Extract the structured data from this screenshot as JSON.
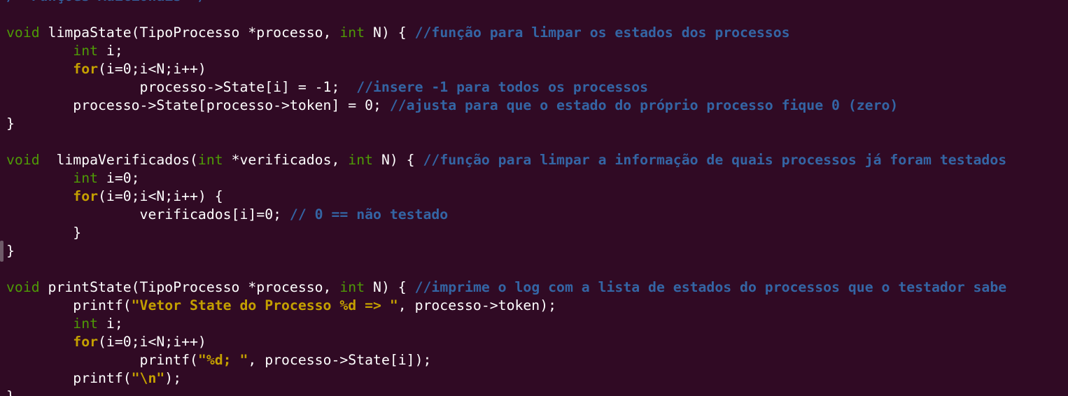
{
  "editor": {
    "colors": {
      "background": "#300a24",
      "default": "#ffffff",
      "type": "#4e9a06",
      "keyword": "#c4a000",
      "string": "#c4a000",
      "comment": "#3465a4"
    },
    "lines": [
      [
        {
          "c": "cmt",
          "t": "/* Funções Adicionais */"
        }
      ],
      [],
      [
        {
          "c": "type",
          "t": "void"
        },
        {
          "c": "",
          "t": " limpaState(TipoProcesso *processo, "
        },
        {
          "c": "type",
          "t": "int"
        },
        {
          "c": "",
          "t": " N) { "
        },
        {
          "c": "cmt",
          "t": "//função para limpar os estados dos processos"
        }
      ],
      [
        {
          "c": "",
          "t": "        "
        },
        {
          "c": "type",
          "t": "int"
        },
        {
          "c": "",
          "t": " i;"
        }
      ],
      [
        {
          "c": "",
          "t": "        "
        },
        {
          "c": "kw",
          "t": "for"
        },
        {
          "c": "",
          "t": "(i=0;i<N;i++)"
        }
      ],
      [
        {
          "c": "",
          "t": "                processo->State[i] = -1;  "
        },
        {
          "c": "cmt",
          "t": "//insere -1 para todos os processos"
        }
      ],
      [
        {
          "c": "",
          "t": "        processo->State[processo->token] = 0; "
        },
        {
          "c": "cmt",
          "t": "//ajusta para que o estado do próprio processo fique 0 (zero)"
        }
      ],
      [
        {
          "c": "",
          "t": "}"
        }
      ],
      [],
      [
        {
          "c": "type",
          "t": "void"
        },
        {
          "c": "",
          "t": "  limpaVerificados("
        },
        {
          "c": "type",
          "t": "int"
        },
        {
          "c": "",
          "t": " *verificados, "
        },
        {
          "c": "type",
          "t": "int"
        },
        {
          "c": "",
          "t": " N) { "
        },
        {
          "c": "cmt",
          "t": "//função para limpar a informação de quais processos já foram testados"
        }
      ],
      [
        {
          "c": "",
          "t": "        "
        },
        {
          "c": "type",
          "t": "int"
        },
        {
          "c": "",
          "t": " i=0;"
        }
      ],
      [
        {
          "c": "",
          "t": "        "
        },
        {
          "c": "kw",
          "t": "for"
        },
        {
          "c": "",
          "t": "(i=0;i<N;i++) {"
        }
      ],
      [
        {
          "c": "",
          "t": "                verificados[i]=0; "
        },
        {
          "c": "cmt",
          "t": "// 0 == não testado"
        }
      ],
      [
        {
          "c": "",
          "t": "        }"
        }
      ],
      [
        {
          "c": "",
          "t": "}"
        }
      ],
      [],
      [
        {
          "c": "type",
          "t": "void"
        },
        {
          "c": "",
          "t": " printState(TipoProcesso *processo, "
        },
        {
          "c": "type",
          "t": "int"
        },
        {
          "c": "",
          "t": " N) { "
        },
        {
          "c": "cmt",
          "t": "//imprime o log com a lista de estados do processos que o testador sabe"
        }
      ],
      [
        {
          "c": "",
          "t": "        printf("
        },
        {
          "c": "str",
          "t": "\"Vetor State do Processo %d => \""
        },
        {
          "c": "",
          "t": ", processo->token);"
        }
      ],
      [
        {
          "c": "",
          "t": "        "
        },
        {
          "c": "type",
          "t": "int"
        },
        {
          "c": "",
          "t": " i;"
        }
      ],
      [
        {
          "c": "",
          "t": "        "
        },
        {
          "c": "kw",
          "t": "for"
        },
        {
          "c": "",
          "t": "(i=0;i<N;i++)"
        }
      ],
      [
        {
          "c": "",
          "t": "                printf("
        },
        {
          "c": "str",
          "t": "\"%d; \""
        },
        {
          "c": "",
          "t": ", processo->State[i]);"
        }
      ],
      [
        {
          "c": "",
          "t": "        printf("
        },
        {
          "c": "str",
          "t": "\"\\n\""
        },
        {
          "c": "",
          "t": ");"
        }
      ],
      [
        {
          "c": "",
          "t": "}"
        }
      ]
    ]
  }
}
